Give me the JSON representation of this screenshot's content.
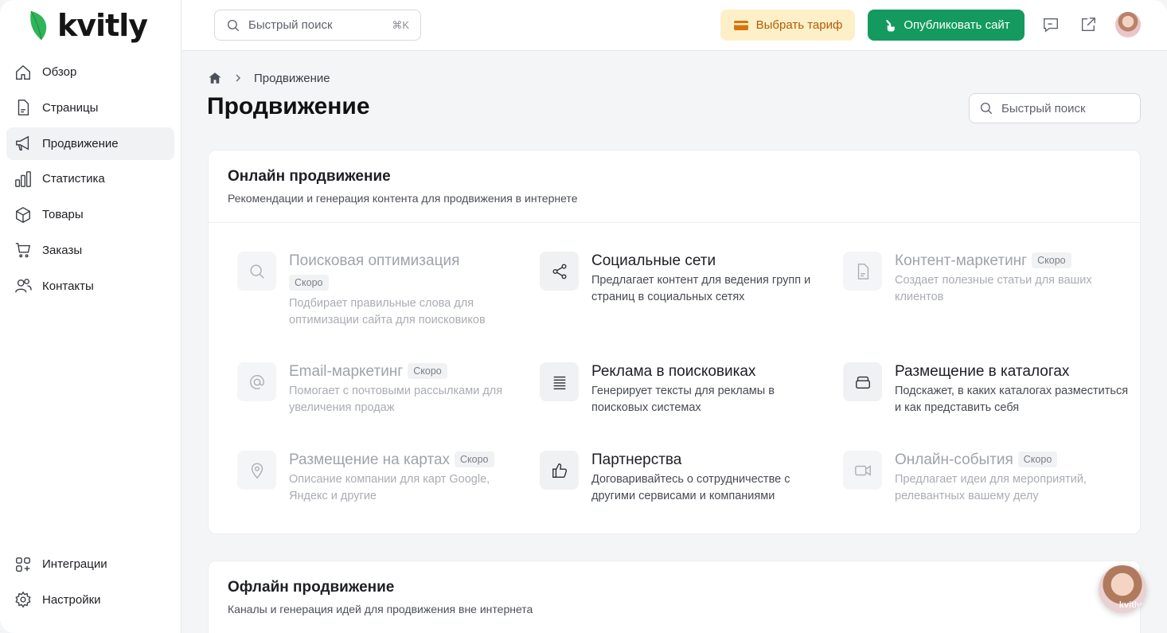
{
  "brand": {
    "name": "kvitly",
    "leaf_color": "#2fb459"
  },
  "sidebar": {
    "items": [
      {
        "label": "Обзор",
        "icon": "home-icon"
      },
      {
        "label": "Страницы",
        "icon": "document-icon"
      },
      {
        "label": "Продвижение",
        "icon": "megaphone-icon",
        "active": true
      },
      {
        "label": "Статистика",
        "icon": "bar-chart-icon"
      },
      {
        "label": "Товары",
        "icon": "box-icon"
      },
      {
        "label": "Заказы",
        "icon": "cart-icon"
      },
      {
        "label": "Контакты",
        "icon": "users-icon"
      }
    ],
    "bottom_items": [
      {
        "label": "Интеграции",
        "icon": "integrations-icon"
      },
      {
        "label": "Настройки",
        "icon": "gear-icon"
      }
    ]
  },
  "topbar": {
    "search_placeholder": "Быстрый поиск",
    "search_shortcut": "⌘K",
    "tariff_label": "Выбрать тариф",
    "publish_label": "Опубликовать сайт"
  },
  "breadcrumb": {
    "current": "Продвижение"
  },
  "page": {
    "title": "Продвижение",
    "search_placeholder": "Быстрый поиск"
  },
  "online": {
    "title": "Онлайн продвижение",
    "subtitle": "Рекомендации и генерация контента для продвижения в интернете",
    "items": [
      {
        "title": "Поисковая оптимизация",
        "badge": "Скоро",
        "desc": "Подбирает правильные слова для оптимизации сайта для поисковиков",
        "icon": "search-icon",
        "disabled": true
      },
      {
        "title": "Социальные сети",
        "desc": "Предлагает контент для ведения групп и страниц в социальных сетях",
        "icon": "share-icon",
        "disabled": false
      },
      {
        "title": "Контент-маркетинг",
        "badge": "Скоро",
        "desc": "Создает полезные статьи для ваших клиентов",
        "icon": "document-icon",
        "disabled": true
      },
      {
        "title": "Email-маркетинг",
        "badge": "Скоро",
        "desc": "Помогает с почтовыми рассылками для увеличения продаж",
        "icon": "at-icon",
        "disabled": true
      },
      {
        "title": "Реклама в поисковиках",
        "desc": "Генерирует тексты для рекламы в поисковых системах",
        "icon": "lines-icon",
        "disabled": false
      },
      {
        "title": "Размещение в каталогах",
        "desc": "Подскажет, в каких каталогах разместиться и как представить себя",
        "icon": "folder-icon",
        "disabled": false
      },
      {
        "title": "Размещение на картах",
        "badge": "Скоро",
        "desc": "Описание компании для карт Google, Яндекс и другие",
        "icon": "map-pin-icon",
        "disabled": true
      },
      {
        "title": "Партнерства",
        "desc": "Договаривайтесь о сотрудничестве с другими сервисами и компаниями",
        "icon": "thumbs-up-icon",
        "disabled": false
      },
      {
        "title": "Онлайн-события",
        "badge": "Скоро",
        "desc": "Предлагает идеи для мероприятий, релевантных вашему делу",
        "icon": "video-icon",
        "disabled": true
      }
    ]
  },
  "offline": {
    "title": "Офлайн продвижение",
    "subtitle": "Каналы и генерация идей для продвижения вне интернета"
  },
  "chat_widget": {
    "label": "kvitly"
  }
}
